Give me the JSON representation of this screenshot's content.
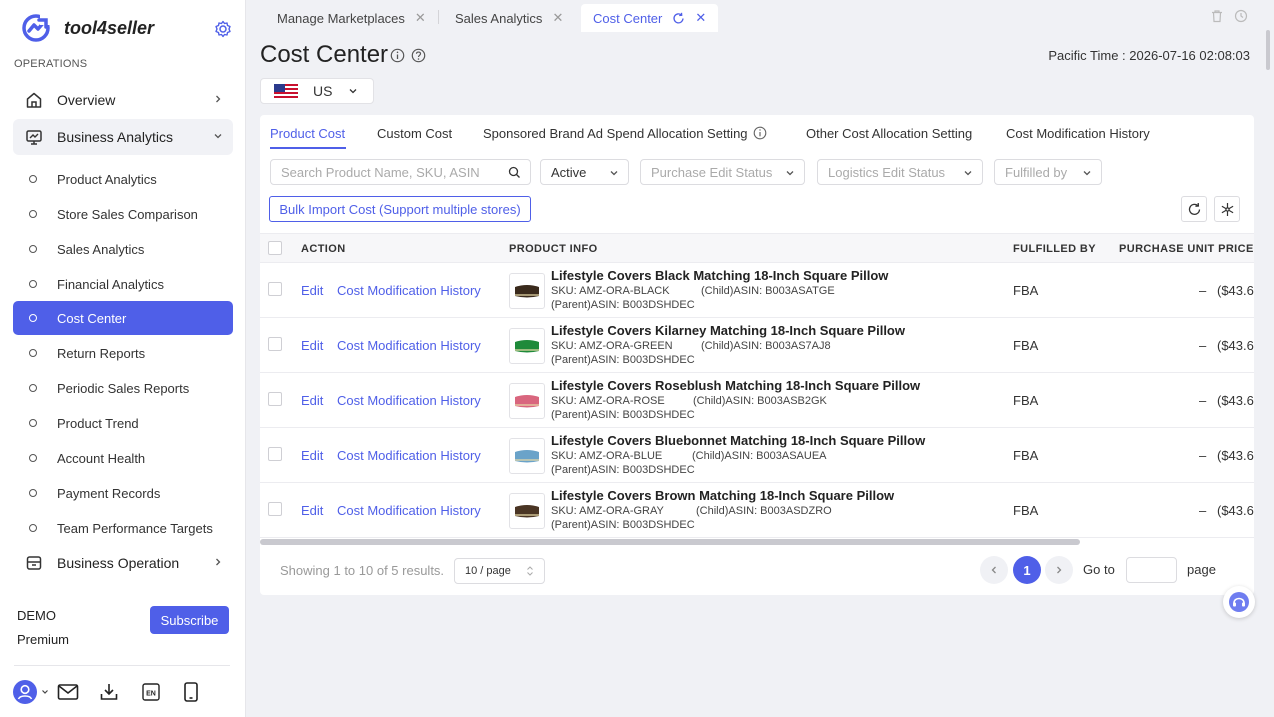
{
  "brand": {
    "name": "tool4seller",
    "accent": "#4f5fe8"
  },
  "sidebar": {
    "section_label": "OPERATIONS",
    "overview": "Overview",
    "business_analytics": "Business Analytics",
    "sub_items": [
      "Product Analytics",
      "Store Sales Comparison",
      "Sales Analytics",
      "Financial Analytics",
      "Cost Center",
      "Return Reports",
      "Periodic Sales Reports",
      "Product Trend",
      "Account Health",
      "Payment Records",
      "Team Performance Targets"
    ],
    "active_item": "Cost Center",
    "business_operation": "Business Operation",
    "account_name": "DEMO",
    "plan": "Premium",
    "subscribe_label": "Subscribe",
    "bottom_icons": [
      "user-icon",
      "mail-icon",
      "download-icon",
      "language-icon",
      "mobile-icon"
    ]
  },
  "tabs": [
    {
      "label": "Manage Marketplaces",
      "active": false
    },
    {
      "label": "Sales Analytics",
      "active": false
    },
    {
      "label": "Cost Center",
      "active": true
    }
  ],
  "header": {
    "title": "Cost Center",
    "pacific_time": "Pacific Time : 2026-07-16 02:08:03",
    "country": "US"
  },
  "subtabs": [
    {
      "label": "Product Cost",
      "active": true
    },
    {
      "label": "Custom Cost",
      "active": false
    },
    {
      "label": "Sponsored Brand Ad Spend Allocation Setting",
      "active": false
    },
    {
      "label": "Other Cost Allocation Setting",
      "active": false
    },
    {
      "label": "Cost Modification History",
      "active": false
    }
  ],
  "filters": {
    "search_placeholder": "Search Product Name, SKU, ASIN",
    "status": "Active",
    "purchase_edit_status": "Purchase Edit Status",
    "logistics_edit_status": "Logistics Edit Status",
    "fulfilled_by": "Fulfilled by"
  },
  "bulk_import_label": "Bulk Import Cost (Support multiple stores)",
  "table": {
    "columns": [
      "ACTION",
      "PRODUCT INFO",
      "FULFILLED BY",
      "PURCHASE UNIT PRICE"
    ],
    "edit_label": "Edit",
    "history_label": "Cost Modification History",
    "rows": [
      {
        "name": "Lifestyle Covers Black Matching 18-Inch Square Pillow",
        "sku": "SKU: AMZ-ORA-BLACK",
        "child": "(Child)ASIN: B003ASATGE",
        "parent": "(Parent)ASIN: B003DSHDEC",
        "fulfilled": "FBA",
        "dash": "–",
        "price": "($43.6",
        "color": "#3a2a1c"
      },
      {
        "name": "Lifestyle Covers Kilarney Matching 18-Inch Square Pillow",
        "sku": "SKU: AMZ-ORA-GREEN",
        "child": "(Child)ASIN: B003AS7AJ8",
        "parent": "(Parent)ASIN: B003DSHDEC",
        "fulfilled": "FBA",
        "dash": "–",
        "price": "($43.6",
        "color": "#1f8a3a"
      },
      {
        "name": "Lifestyle Covers Roseblush Matching 18-Inch Square Pillow",
        "sku": "SKU: AMZ-ORA-ROSE",
        "child": "(Child)ASIN: B003ASB2GK",
        "parent": "(Parent)ASIN: B003DSHDEC",
        "fulfilled": "FBA",
        "dash": "–",
        "price": "($43.6",
        "color": "#d9667e"
      },
      {
        "name": "Lifestyle Covers Bluebonnet Matching 18-Inch Square Pillow",
        "sku": "SKU: AMZ-ORA-BLUE",
        "child": "(Child)ASIN: B003ASAUEA",
        "parent": "(Parent)ASIN: B003DSHDEC",
        "fulfilled": "FBA",
        "dash": "–",
        "price": "($43.6",
        "color": "#6aa3c9"
      },
      {
        "name": "Lifestyle Covers Brown Matching 18-Inch Square Pillow",
        "sku": "SKU: AMZ-ORA-GRAY",
        "child": "(Child)ASIN: B003ASDZRO",
        "parent": "(Parent)ASIN: B003DSHDEC",
        "fulfilled": "FBA",
        "dash": "–",
        "price": "($43.6",
        "color": "#4a3524"
      }
    ]
  },
  "pagination": {
    "showing": "Showing 1 to 10 of 5 results.",
    "per_page": "10 / page",
    "current_page": "1",
    "goto_label": "Go to",
    "page_label": "page"
  }
}
